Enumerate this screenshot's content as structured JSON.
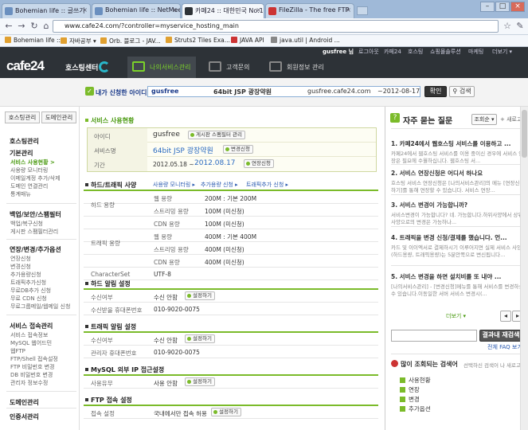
{
  "browser": {
    "tabs": [
      {
        "label": "Bohemian life :: 글쓰기"
      },
      {
        "label": "Bohemian life :: NetMeet"
      },
      {
        "label": "카페24 :: 대한민국 No.1 카"
      },
      {
        "label": "FileZilla - The free FTP"
      }
    ],
    "address": "www.cafe24.com/?controller=myservice_hosting_main",
    "bookmarks": [
      "Bohemian life ::",
      "자바공부 ▾",
      "Orb. 블로그 - JAV...",
      "Struts2 Tiles Exa...",
      "JAVA API",
      "java.util | Android ..."
    ]
  },
  "topnav": {
    "user": "gusfree 님",
    "items": [
      "로그아웃",
      "카페24",
      "호스팅",
      "쇼핑몰솔루션",
      "마케팅",
      "더보기 ▾"
    ]
  },
  "header": {
    "logo": "cafe24",
    "sub": "호스팅센터",
    "menu": [
      "나의서비스관리",
      "고객문의",
      "회원정보 관리"
    ]
  },
  "selector": {
    "label": "내가 신청한 아이디 목록 :",
    "id": "gusfree",
    "product": "64bit JSP 광장약원",
    "domain": "gusfree.cafe24.com",
    "period": "~2012-08-17",
    "confirm": "확인",
    "search": "검색"
  },
  "sidebar": {
    "tabs": [
      "호스팅관리",
      "도메인관리"
    ],
    "groups": [
      {
        "title": "호스팅관리",
        "items": []
      },
      {
        "title": "기본관리",
        "items": [
          "서비스 사용현황 >",
          "사용량 모니터링",
          "이메일계정 추가/삭제",
          "도메인 연결관리",
          "통계매뉴"
        ]
      },
      {
        "title": "백업/보안/스팸필터",
        "items": [
          "백업/복구신청",
          "게시판 스팸필터관리"
        ]
      },
      {
        "title": "연장/변경/추가옵션",
        "items": [
          "연장신청",
          "변경신청",
          "추가용량신청",
          "트래픽추가신청",
          "무료DB추가 신청",
          "무료 CDN 신청",
          "무료그룹메일/웹메일 신청"
        ]
      },
      {
        "title": "서비스 접속관리",
        "items": [
          "서비스 접속정보",
          "MySQL 웹어드민",
          "웹FTP",
          "FTP/Shell 접속설정",
          "FTP 비밀번호 변경",
          "DB 비밀번호 변경",
          "관리자 정보수정"
        ]
      },
      {
        "title": "도메인관리",
        "items": []
      },
      {
        "title": "인증서관리",
        "items": []
      }
    ]
  },
  "main": {
    "title": "서비스 사용현황",
    "service": {
      "id_label": "아이디",
      "id": "gusfree",
      "id_btn": "게시판 스팸필터 관리",
      "name_label": "서비스명",
      "name": "64bit JSP 광장약원",
      "name_btn": "변경신청",
      "period_label": "기간",
      "period_start": "2012.05.18 ~",
      "period_end": "2012.08.17",
      "period_btn": "연장신청"
    },
    "disk": {
      "title": "하드/트래픽 사양",
      "links": [
        "사용량 모니터링 ▸",
        "추가용량 신청 ▸",
        "트래픽추가 신청 ▸"
      ],
      "rows": [
        {
          "k": "하드 용량",
          "sub": "웹 용량",
          "v": "200M : 기본 200M"
        },
        {
          "k": "",
          "sub": "스트리밍 용량",
          "v": "100M (미신청)"
        },
        {
          "k": "",
          "sub": "CDN 용량",
          "v": "100M (미신청)"
        },
        {
          "k": "트래픽 용량",
          "sub": "웹 용량",
          "v": "400M : 기본 400M"
        },
        {
          "k": "",
          "sub": "스트리밍 용량",
          "v": "400M (미신청)"
        },
        {
          "k": "",
          "sub": "CDN 용량",
          "v": "400M (미신청)"
        }
      ],
      "charset_label": "CharacterSet",
      "charset": "UTF-8"
    },
    "hard_alert": {
      "title": "하드 알림 설정",
      "recv_label": "수신여부",
      "recv": "수신 안함",
      "btn": "설정하기",
      "phone_label": "수신받을 휴대폰번호",
      "phone": "010-9020-0075"
    },
    "traffic_alert": {
      "title": "트래픽 알림 설정",
      "recv_label": "수신여부",
      "recv": "수신 안함",
      "btn": "설정하기",
      "phone_label": "관리자 휴대폰번호",
      "phone": "010-9020-0075"
    },
    "mysql": {
      "title": "MySQL 외부 IP 접근설정",
      "label": "사용유무",
      "value": "사용 안함",
      "btn": "설정하기"
    },
    "ftp": {
      "title": "FTP 접속 설정",
      "label": "접속 설정",
      "value": "국내에서만 접속 허용",
      "btn": "설정하기"
    }
  },
  "faq": {
    "title": "자주 묻는 질문",
    "sort": "조회순 ▾",
    "more": "+ 새로고",
    "items": [
      {
        "q": "1. 카페24에서 웹호스팅 서비스를 이용하고 ...",
        "a": "카페24에서 웹호스팅 서비스를 이용 중이신 경우에 서비스 연장은 필요에 수월하십니다. 웹호스팅 서..."
      },
      {
        "q": "2. 서비스 연장신청은 어디서 하나요",
        "a": "호스팅 서비스 연장신청은 [나의서비스관리]의 메뉴 [연장신청하기]를 통해 연장할 수 있습니다. 서비스 연장..."
      },
      {
        "q": "3. 서비스 변경이 가능합니까?",
        "a": "서비스변경이 가능합니다? 네. 가능합니다.하위사양에서 상위사양으로의 변경은 가능하나..."
      },
      {
        "q": "4. 트래픽을 변경 신청/결제를 했습니다. 언...",
        "a": "카드 및 이이엑서로 결제하시기 이루어지면 실제 서비스 사양(하드용량, 트래픽용량)는 5분안쪽으로 변신됩니다..."
      },
      {
        "q": "5. 서비스 변경을 하면 설치비를 또 내야 ...",
        "a": "[나의서비스관리] - [변경신청]메뉴를 통해 서비스를 변경하실 수 있습니다.이동일한 서버 서비스 변경시(..."
      }
    ],
    "more_link": "더보기 ▾",
    "search_btn": "결과내 재검색",
    "faq_all": "전체 FAQ 보기",
    "popular_title": "많이 조회되는 검색어",
    "popular_note": "선택하신 검색어 나 새로고",
    "popular": [
      "사용현황",
      "연장",
      "변경",
      "추가옵션"
    ]
  }
}
